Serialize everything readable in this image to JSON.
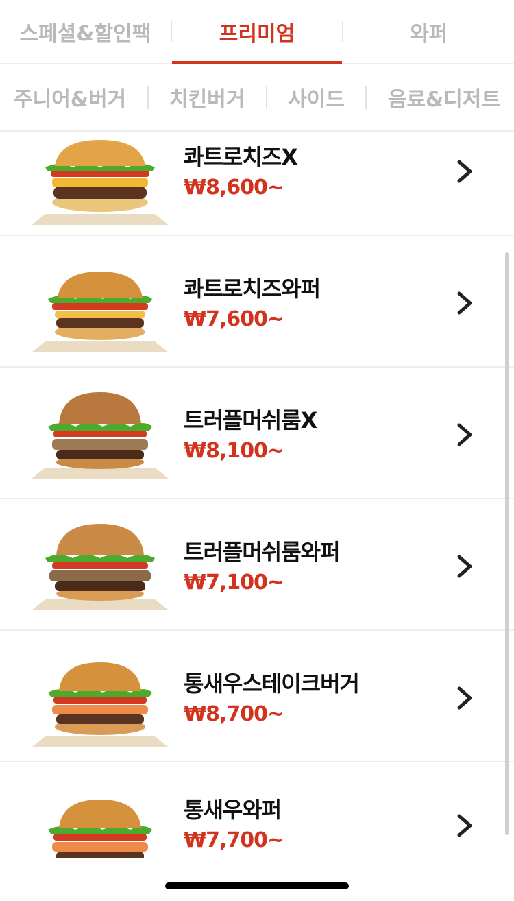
{
  "tabs_top": [
    {
      "label": "스페셜&할인팩",
      "active": false
    },
    {
      "label": "프리미엄",
      "active": true
    },
    {
      "label": "와퍼",
      "active": false
    }
  ],
  "tabs_sub": [
    "주니어&버거",
    "치킨버거",
    "사이드",
    "음료&디저트"
  ],
  "items": [
    {
      "name": "콰트로치즈X",
      "price": "₩8,600~"
    },
    {
      "name": "콰트로치즈와퍼",
      "price": "₩7,600~"
    },
    {
      "name": "트러플머쉬룸X",
      "price": "₩8,100~"
    },
    {
      "name": "트러플머쉬룸와퍼",
      "price": "₩7,100~"
    },
    {
      "name": "통새우스테이크버거",
      "price": "₩8,700~"
    },
    {
      "name": "통새우와퍼",
      "price": "₩7,700~"
    }
  ],
  "icons": {
    "item_arrow": "chevron-right-icon",
    "item_image": "burger-icon"
  },
  "colors": {
    "accent": "#d1331f",
    "inactive_tab": "#b9b9b9",
    "text": "#111111"
  }
}
